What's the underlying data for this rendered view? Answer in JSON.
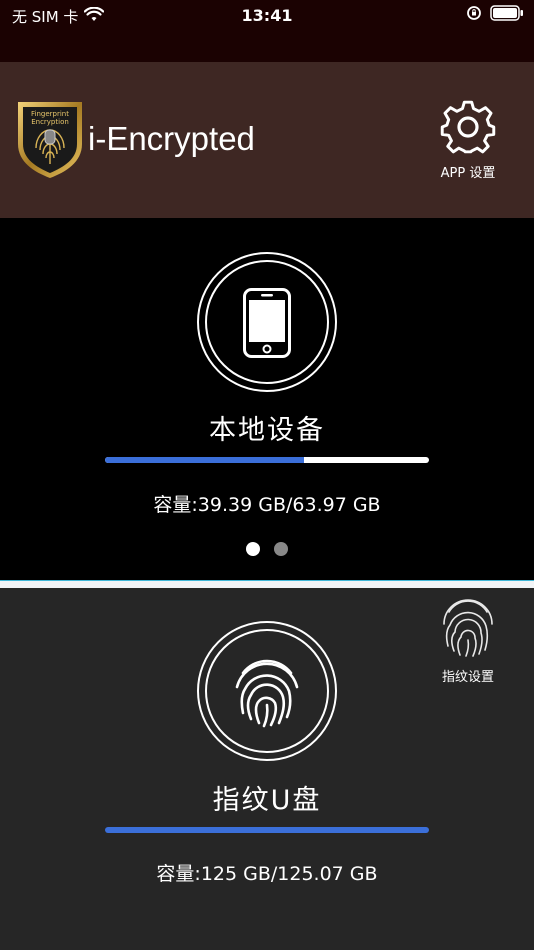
{
  "status_bar": {
    "carrier": "无 SIM 卡",
    "time": "13:41"
  },
  "header": {
    "app_title": "i-Encrypted",
    "logo_text_line1": "Fingerprint",
    "logo_text_line2": "Encryption",
    "settings_label": "APP 设置"
  },
  "local_device": {
    "title": "本地设备",
    "capacity": "容量:39.39 GB/63.97 GB",
    "used_fraction": 0.6157
  },
  "pager": {
    "pages": 2,
    "active": 0
  },
  "usb_drive": {
    "title": "指纹U盘",
    "capacity": "容量:125 GB/125.07 GB",
    "used_fraction": 1.0,
    "fingerprint_settings_label": "指纹设置"
  },
  "colors": {
    "status_bg": "#1b0202",
    "header_bg": "#3e2723",
    "accent_blue": "#3b6fd9",
    "usb_bg": "#262626"
  }
}
